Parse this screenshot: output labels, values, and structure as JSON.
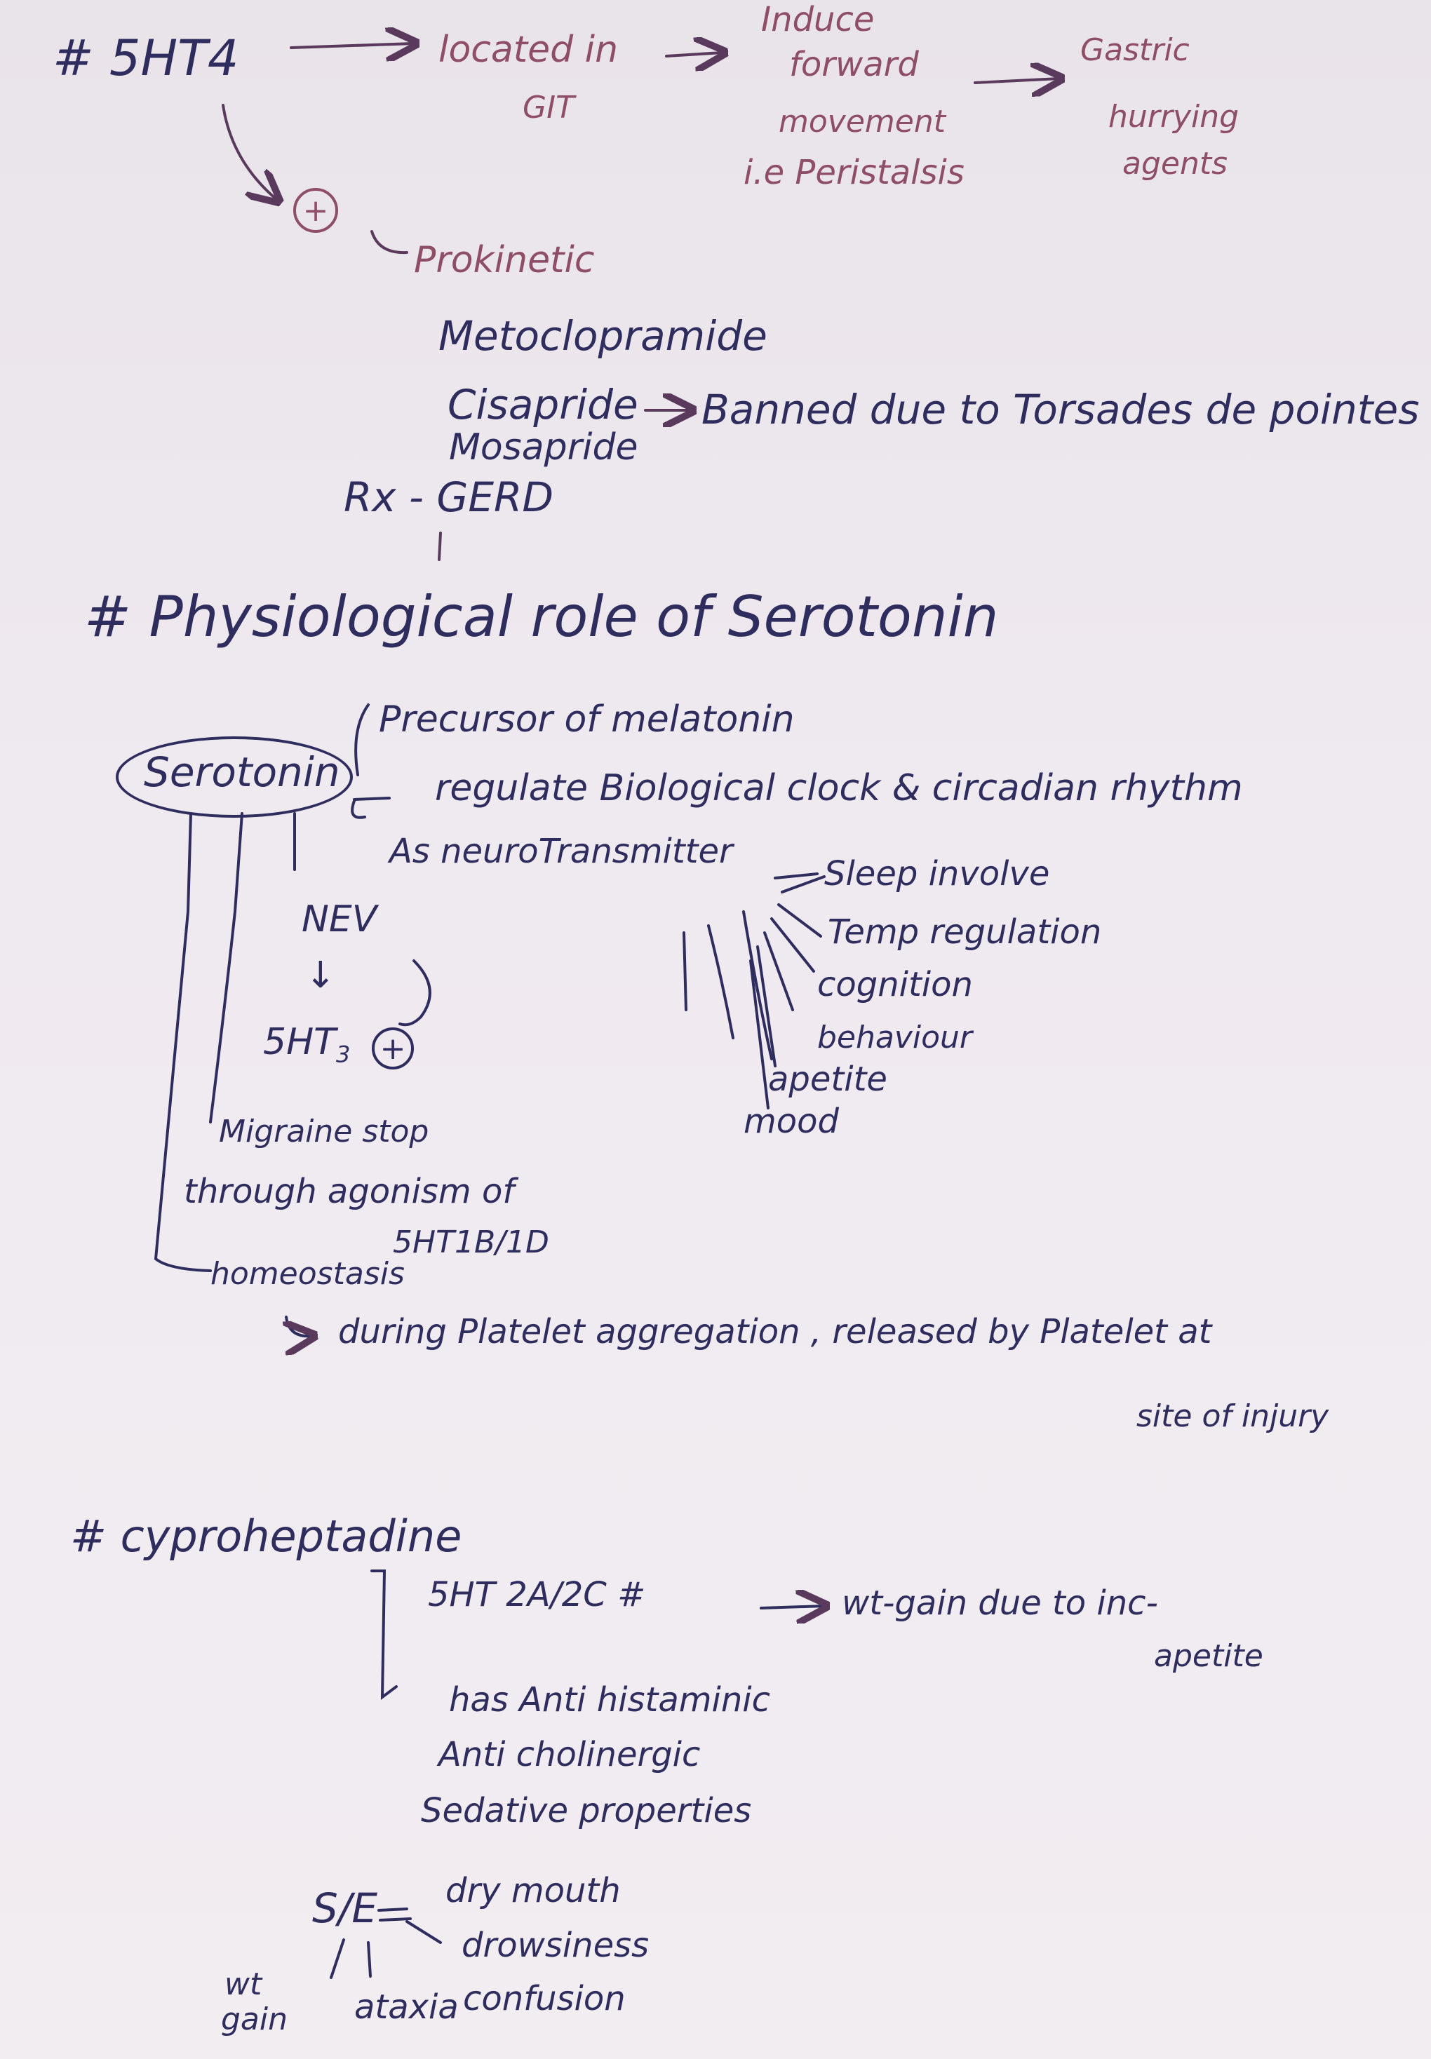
{
  "section1": {
    "heading": "# 5HT4",
    "located": "located in",
    "git": "GIT",
    "induce": "Induce",
    "forward": "forward",
    "movement": "movement",
    "peristalsis": "i.e Peristalsis",
    "gastric": "Gastric",
    "hurrying": "hurrying",
    "agents": "agents",
    "plus": "+",
    "prokinetic": "Prokinetic",
    "drug1": "Metoclopramide",
    "drug2": "Cisapride",
    "banned": "Banned due to Torsades de pointes",
    "drug3": "Mosapride",
    "rx": "Rx - GERD"
  },
  "section2": {
    "heading": "# Physiological role of Serotonin",
    "serotonin": "Serotonin",
    "precursor": "Precursor of melatonin",
    "regulate": "regulate Biological clock & circadian rhythm",
    "neurotransmitter": "As neuroTransmitter",
    "roles": [
      "Sleep involve",
      "Temp regulation",
      "cognition",
      "behaviour",
      "apetite",
      "mood"
    ],
    "nev": "NEV",
    "down_arrow": "↓",
    "fiveht3": "5HT",
    "fiveht3_sub": "3",
    "plus": "+",
    "migraine1": "Migraine stop",
    "migraine2": "through agonism of",
    "migraine3": "5HT1B/1D",
    "homeostasis": "homeostasis",
    "during": "during Platelet aggregation , released by Platelet at",
    "site": "site of injury"
  },
  "section3": {
    "heading": "# cyproheptadine",
    "receptor": "5HT 2A/2C #",
    "wtgain": "wt-gain due to inc-",
    "apetite": "apetite",
    "has": "has Anti histaminic",
    "anticholinergic": "Anti cholinergic",
    "sedative": "Sedative properties",
    "se_label": "S/E",
    "se_items": [
      "dry mouth",
      "drowsiness",
      "confusion"
    ],
    "wt": "wt",
    "gain": "gain",
    "ataxia": "ataxia"
  }
}
